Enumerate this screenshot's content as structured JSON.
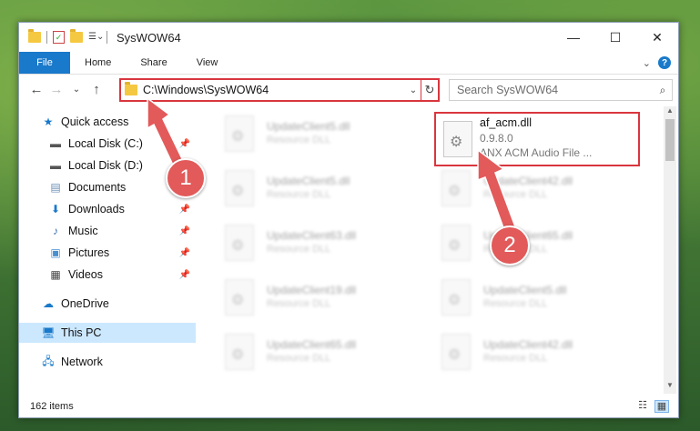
{
  "window": {
    "title": "SysWOW64",
    "controls": {
      "minimize": "—",
      "maximize": "☐",
      "close": "✕"
    }
  },
  "ribbon": {
    "tabs": [
      "File",
      "Home",
      "Share",
      "View"
    ]
  },
  "nav": {
    "back": "←",
    "forward": "→",
    "recent": "⌄",
    "up": "↑",
    "address": "C:\\Windows\\SysWOW64",
    "search_placeholder": "Search SysWOW64"
  },
  "sidebar": {
    "items": [
      {
        "label": "Quick access",
        "icon": "star-icon"
      },
      {
        "label": "Local Disk (C:)",
        "icon": "drive-icon",
        "pinned": true
      },
      {
        "label": "Local Disk (D:)",
        "icon": "drive-icon"
      },
      {
        "label": "Documents",
        "icon": "documents-icon",
        "pinned": true
      },
      {
        "label": "Downloads",
        "icon": "download-icon",
        "pinned": true
      },
      {
        "label": "Music",
        "icon": "music-icon",
        "pinned": true
      },
      {
        "label": "Pictures",
        "icon": "pictures-icon",
        "pinned": true
      },
      {
        "label": "Videos",
        "icon": "videos-icon",
        "pinned": true
      },
      {
        "label": "OneDrive",
        "icon": "cloud-icon"
      },
      {
        "label": "This PC",
        "icon": "computer-icon",
        "selected": true
      },
      {
        "label": "Network",
        "icon": "network-icon"
      }
    ]
  },
  "files": {
    "left_column": [
      {
        "name": "UpdateClient5.dll",
        "type": "Resource DLL"
      },
      {
        "name": "UpdateClient5.dll",
        "type": "Resource DLL"
      },
      {
        "name": "UpdateClient63.dll",
        "type": "Resource DLL"
      },
      {
        "name": "UpdateClient19.dll",
        "type": "Resource DLL"
      },
      {
        "name": "UpdateClient65.dll",
        "type": "Resource DLL"
      }
    ],
    "right_column": [
      {
        "name": "UpdateClient42.dll",
        "type": "Resource DLL"
      },
      {
        "name": "UpdateClient65.dll",
        "type": "Resource DLL"
      },
      {
        "name": "UpdateClient5.dll",
        "type": "Resource DLL"
      },
      {
        "name": "UpdateClient42.dll",
        "type": "Resource DLL"
      }
    ],
    "highlighted": {
      "name": "af_acm.dll",
      "version": "0.9.8.0",
      "description": "ANX ACM Audio File ..."
    }
  },
  "status": {
    "count": "162 items"
  },
  "annotations": {
    "step1": "1",
    "step2": "2",
    "color": "#e25a5a"
  }
}
